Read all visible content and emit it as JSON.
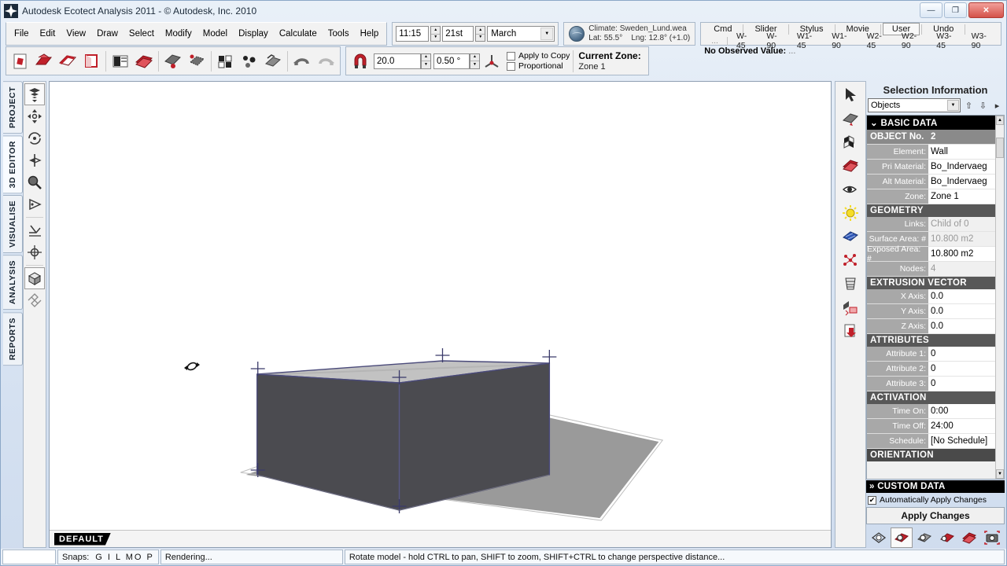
{
  "window": {
    "title": "Autodesk Ecotect Analysis 2011 - © Autodesk, Inc. 2010",
    "minimize": "—",
    "maximize": "❐",
    "close": "✕"
  },
  "menu": {
    "items": [
      "File",
      "Edit",
      "View",
      "Draw",
      "Select",
      "Modify",
      "Model",
      "Display",
      "Calculate",
      "Tools",
      "Help"
    ]
  },
  "datetime": {
    "time": "11:15",
    "day": "21st",
    "month": "March"
  },
  "climate": {
    "line1": "Climate: Sweden_Lund.wea",
    "line2_lat": "Lat: 55.5°",
    "line2_lng": "Lng: 12.8° (+1.0)"
  },
  "modes": {
    "items": [
      "Cmd",
      "Slider",
      "Stylus",
      "Movie",
      "User",
      "Undo"
    ],
    "selected": "User"
  },
  "wbuttons": {
    "ellipsis": "...",
    "items": [
      "W-45",
      "W-90",
      "W1-45",
      "W1-90",
      "W2-45",
      "W2-90",
      "W3-45",
      "W3-90"
    ]
  },
  "observed": {
    "label": "No Observed Value:",
    "value": "..."
  },
  "toolbar": {
    "snap_value": "20.0",
    "angle_value": "0.50 °",
    "apply_to_copy": "Apply to Copy",
    "proportional": "Proportional",
    "current_zone_label": "Current Zone:",
    "current_zone_value": "Zone 1"
  },
  "vtabs": {
    "items": [
      "PROJECT",
      "3D EDITOR",
      "VISUALISE",
      "ANALYSIS",
      "REPORTS"
    ],
    "selected": "3D EDITOR"
  },
  "viewport": {
    "tab_label": "DEFAULT"
  },
  "panel": {
    "title": "Selection Information",
    "filter_value": "Objects",
    "sections": {
      "basic_data": "BASIC DATA",
      "geometry": "GEOMETRY",
      "extrusion_vector": "EXTRUSION VECTOR",
      "attributes": "ATTRIBUTES",
      "activation": "ACTIVATION",
      "orientation": "ORIENTATION",
      "custom_data": "CUSTOM DATA"
    },
    "object_no_label": "OBJECT No.",
    "object_no_value": "2",
    "basic_rows": [
      {
        "label": "Element:",
        "value": "Wall",
        "dim": false
      },
      {
        "label": "Pri Material:",
        "value": "Bo_Indervaeg",
        "dim": false
      },
      {
        "label": "Alt Material:",
        "value": "Bo_Indervaeg",
        "dim": false
      },
      {
        "label": "Zone:",
        "value": "Zone 1",
        "dim": false
      }
    ],
    "geometry_rows": [
      {
        "label": "Links:",
        "value": "Child of 0",
        "dim": true
      },
      {
        "label": "Surface Area: #",
        "value": "10.800 m2",
        "dim": true
      },
      {
        "label": "Exposed Area: #",
        "value": "10.800 m2",
        "dim": false
      },
      {
        "label": "Nodes:",
        "value": "4",
        "dim": true
      }
    ],
    "extrusion_rows": [
      {
        "label": "X Axis:",
        "value": "0.0",
        "dim": false
      },
      {
        "label": "Y Axis:",
        "value": "0.0",
        "dim": false
      },
      {
        "label": "Z Axis:",
        "value": "0.0",
        "dim": false
      }
    ],
    "attribute_rows": [
      {
        "label": "Attribute 1:",
        "value": "0",
        "dim": false
      },
      {
        "label": "Attribute 2:",
        "value": "0",
        "dim": false
      },
      {
        "label": "Attribute 3:",
        "value": "0",
        "dim": false
      }
    ],
    "activation_rows": [
      {
        "label": "Time On:",
        "value": "0:00",
        "dim": false
      },
      {
        "label": "Time Off:",
        "value": "24:00",
        "dim": false
      },
      {
        "label": "Schedule:",
        "value": "[No Schedule]",
        "dim": false
      }
    ],
    "auto_apply": "Automatically Apply Changes",
    "apply_button": "Apply Changes",
    "chevron_down": "⌄",
    "chevron_right": "»"
  },
  "status": {
    "snaps_label": "Snaps:",
    "snaps_value": "G I  L  MO P",
    "rendering": "Rendering...",
    "hint": "Rotate model - hold CTRL to pan, SHIFT to zoom, SHIFT+CTRL to change perspective distance..."
  },
  "colors": {
    "accent_red": "#c0202a",
    "panel_header": "#000000",
    "label_gray": "#a8a8a8",
    "model_wall": "#4b4b50",
    "model_roof": "#bdbdbd",
    "ground_shadow": "#9a9a9a",
    "titlebar": "#dbe6f4"
  }
}
